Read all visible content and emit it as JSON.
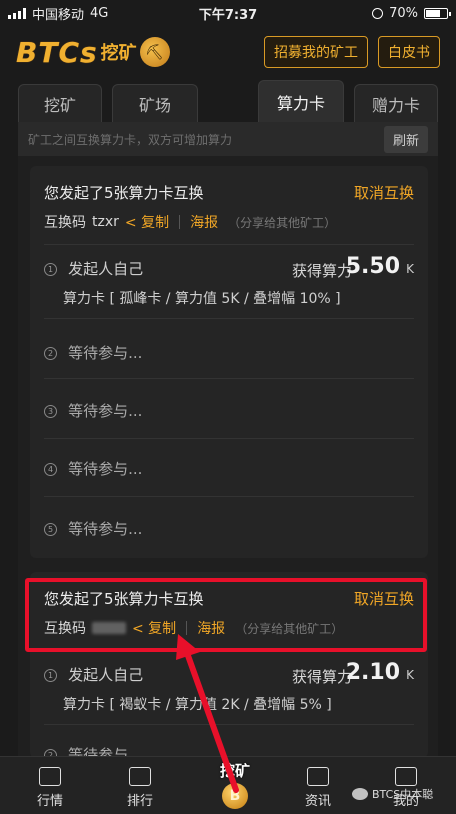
{
  "status_bar": {
    "carrier": "中国移动",
    "network": "4G",
    "time": "下午7:37",
    "battery": "70%",
    "battery_level": 0.7
  },
  "header": {
    "logo_text": "BTCs",
    "logo_sub": "挖矿",
    "recruit_button": "招募我的矿工",
    "whitepaper_button": "白皮书"
  },
  "tabs": [
    {
      "label": "挖矿"
    },
    {
      "label": "矿场"
    },
    {
      "label": "算力卡",
      "active": true
    },
    {
      "label": "赠力卡"
    }
  ],
  "info": {
    "text": "矿工之间互换算力卡，双方可增加算力",
    "refresh_label": "刷新"
  },
  "exchanges": [
    {
      "title": "您发起了5张算力卡互换",
      "cancel_label": "取消互换",
      "code_label": "互换码",
      "code_value": "tzxr",
      "copy_label": "< 复制",
      "poster_label": "海报",
      "share_hint": "（分享给其他矿工）",
      "initiator_label": "发起人自己",
      "power_label": "获得算力",
      "power_value": "5.50",
      "power_unit": "K",
      "card_detail": "算力卡 [ 孤峰卡 / 算力值 5K / 叠增幅 10% ]",
      "waiting": [
        "等待参与...",
        "等待参与...",
        "等待参与...",
        "等待参与..."
      ]
    },
    {
      "title": "您发起了5张算力卡互换",
      "cancel_label": "取消互换",
      "code_label": "互换码",
      "copy_label": "< 复制",
      "poster_label": "海报",
      "share_hint": "（分享给其他矿工）",
      "initiator_label": "发起人自己",
      "power_label": "获得算力",
      "power_value": "2.10",
      "power_unit": "K",
      "card_detail": "算力卡 [ 褐蚁卡 / 算力值 2K / 叠增幅 5% ]",
      "waiting": [
        "等待参与"
      ]
    }
  ],
  "slot_numbers": [
    "1",
    "2",
    "3",
    "4",
    "5"
  ],
  "nav": {
    "market": "行情",
    "ranking": "排行",
    "mining": "挖矿",
    "coin_symbol": "B",
    "news": "资讯",
    "mine": "我的"
  },
  "watermark": "BTCS中本聪",
  "colors": {
    "accent": "#f0a626",
    "highlight": "#e8102a",
    "background": "#1b1b1b"
  }
}
